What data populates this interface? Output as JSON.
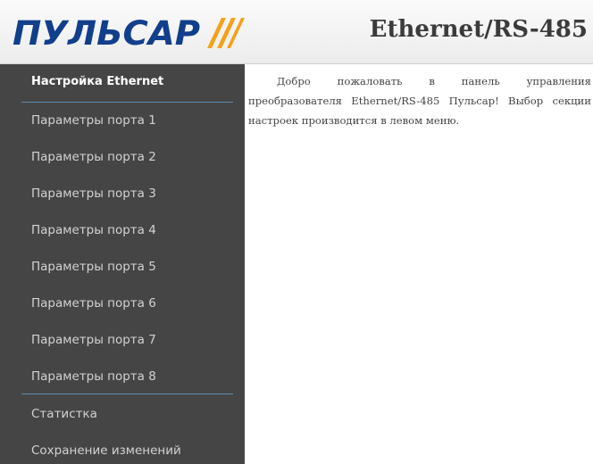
{
  "header": {
    "logo_text": "ПУЛЬСАР",
    "title": "Ethernet/RS-485"
  },
  "colors": {
    "logo_blue": "#123f8c",
    "logo_orange": "#f5a21a",
    "sidebar_bg": "#454545",
    "divider": "#5e8bb4"
  },
  "sidebar": {
    "items": [
      {
        "label": "Настройка Ethernet"
      },
      {
        "label": "Параметры порта 1"
      },
      {
        "label": "Параметры порта 2"
      },
      {
        "label": "Параметры порта 3"
      },
      {
        "label": "Параметры порта 4"
      },
      {
        "label": "Параметры порта 5"
      },
      {
        "label": "Параметры порта 6"
      },
      {
        "label": "Параметры порта 7"
      },
      {
        "label": "Параметры порта 8"
      },
      {
        "label": "Статистка"
      },
      {
        "label": "Сохранение изменений"
      }
    ]
  },
  "main": {
    "intro_text": "Добро пожаловать в панель управления преобразователя Ethernet/RS-485 Пульсар! Выбор секции настроек производится в левом меню."
  }
}
